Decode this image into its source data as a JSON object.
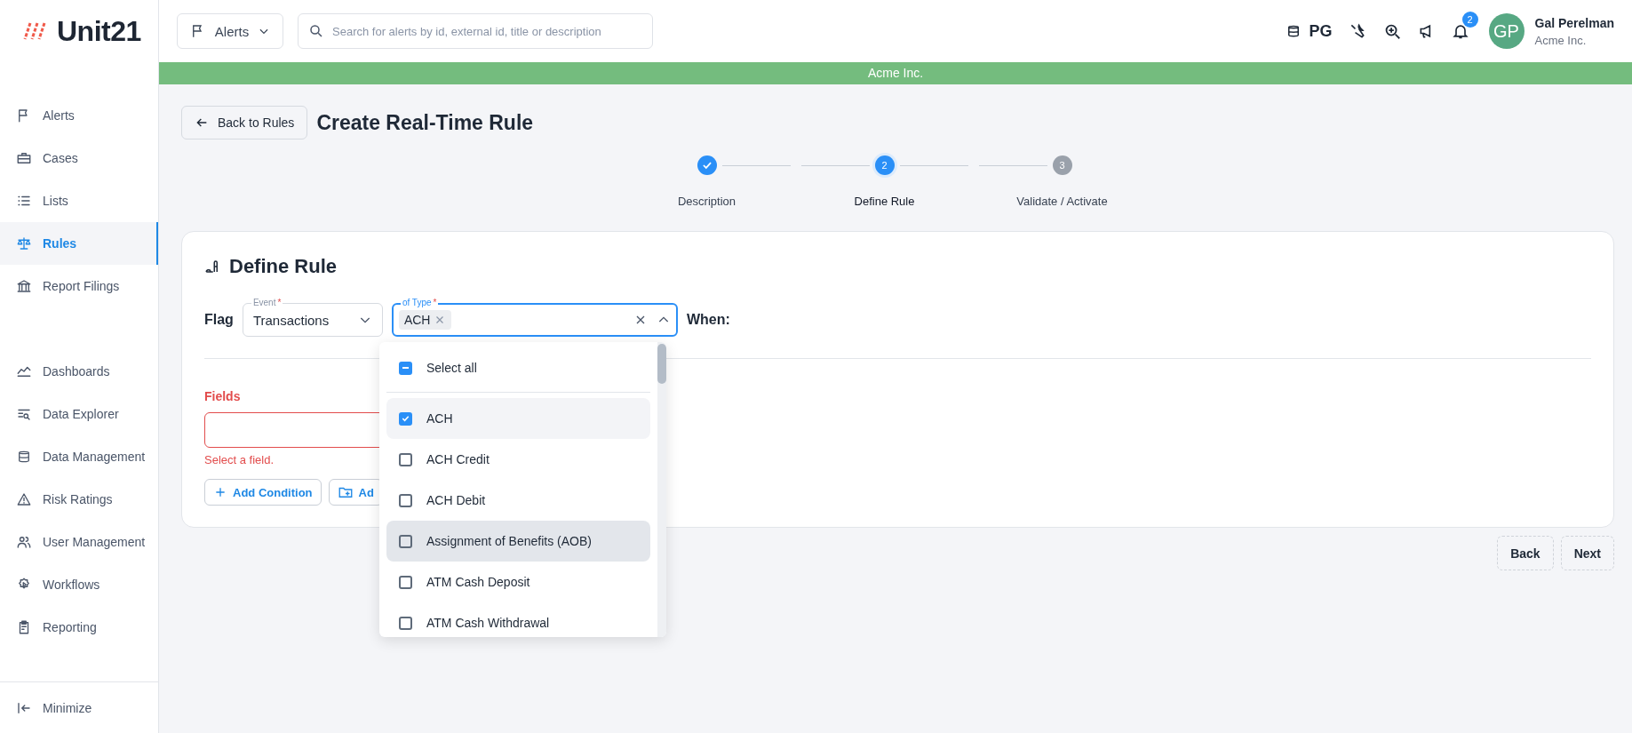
{
  "logo": {
    "text": "Unit21"
  },
  "topbar": {
    "module_select": {
      "label": "Alerts"
    },
    "search": {
      "placeholder": "Search for alerts by id, external id, title or description"
    },
    "db_label": "PG",
    "notifications": {
      "count": "2"
    },
    "user": {
      "initials": "GP",
      "name": "Gal Perelman",
      "org": "Acme Inc."
    }
  },
  "banner": "Acme Inc.",
  "sidebar": {
    "items": [
      {
        "label": "Alerts",
        "selected": false
      },
      {
        "label": "Cases",
        "selected": false
      },
      {
        "label": "Lists",
        "selected": false
      },
      {
        "label": "Rules",
        "selected": true
      },
      {
        "label": "Report Filings",
        "selected": false
      },
      {
        "label": "Dashboards",
        "selected": false
      },
      {
        "label": "Data Explorer",
        "selected": false
      },
      {
        "label": "Data Management",
        "selected": false
      },
      {
        "label": "Risk Ratings",
        "selected": false
      },
      {
        "label": "User Management",
        "selected": false
      },
      {
        "label": "Workflows",
        "selected": false
      },
      {
        "label": "Reporting",
        "selected": false
      }
    ],
    "minimize": "Minimize"
  },
  "page": {
    "back_button": "Back to Rules",
    "title": "Create Real-Time Rule"
  },
  "stepper": [
    {
      "label": "Description",
      "completed": true,
      "active": false
    },
    {
      "number": "2",
      "label": "Define Rule",
      "completed": false,
      "active": true
    },
    {
      "number": "3",
      "label": "Validate / Activate",
      "completed": false,
      "active": false
    }
  ],
  "card": {
    "title": "Define Rule",
    "flag_label": "Flag",
    "event": {
      "label": "Event",
      "required_mark": "*",
      "value": "Transactions"
    },
    "type": {
      "label": "of Type",
      "required_mark": "*",
      "chips": [
        "ACH"
      ],
      "focused": true
    },
    "when_label": "When:",
    "fields": {
      "label": "Fields",
      "error": "Select a field."
    },
    "buttons": [
      "Add Condition",
      "Ad"
    ]
  },
  "dropdown": {
    "select_all": {
      "label": "Select all",
      "indeterminate": true
    },
    "options": [
      {
        "label": "ACH",
        "checked": true,
        "highlighted": false
      },
      {
        "label": "ACH Credit",
        "checked": false,
        "highlighted": false
      },
      {
        "label": "ACH Debit",
        "checked": false,
        "highlighted": false
      },
      {
        "label": "Assignment of Benefits (AOB)",
        "checked": false,
        "highlighted": true
      },
      {
        "label": "ATM Cash Deposit",
        "checked": false,
        "highlighted": false
      },
      {
        "label": "ATM Cash Withdrawal",
        "checked": false,
        "highlighted": false
      }
    ]
  },
  "footer_buttons": [
    "Back",
    "Next"
  ]
}
